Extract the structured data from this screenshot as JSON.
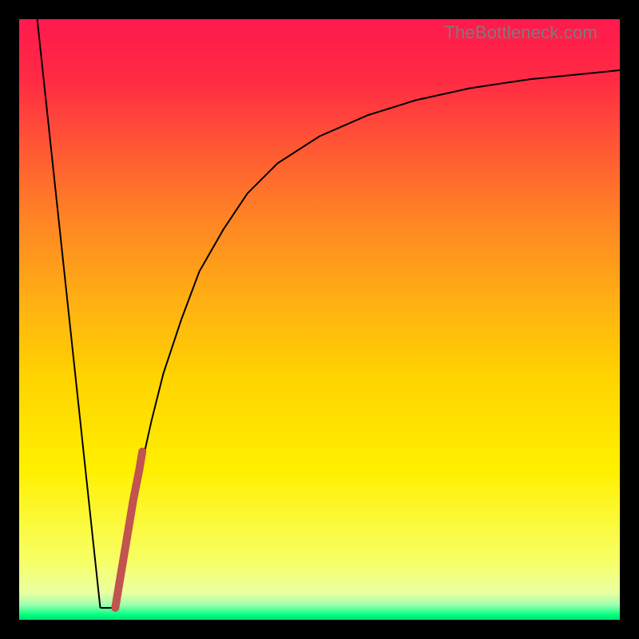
{
  "watermark": "TheBottleneck.com",
  "chart_data": {
    "type": "line",
    "title": "",
    "xlabel": "",
    "ylabel": "",
    "xlim": [
      0,
      100
    ],
    "ylim": [
      0,
      100
    ],
    "grid": false,
    "legend": false,
    "series": [
      {
        "name": "left-descent",
        "color": "#000000",
        "width": 2,
        "x": [
          3,
          13.5
        ],
        "y": [
          100,
          2
        ]
      },
      {
        "name": "floor",
        "color": "#000000",
        "width": 2,
        "x": [
          13.5,
          16
        ],
        "y": [
          2,
          2
        ]
      },
      {
        "name": "right-growth",
        "color": "#000000",
        "width": 2,
        "x": [
          16,
          18,
          20,
          22,
          24,
          27,
          30,
          34,
          38,
          43,
          50,
          58,
          66,
          75,
          85,
          95,
          100
        ],
        "y": [
          2,
          13,
          24,
          33,
          41,
          50,
          58,
          65,
          71,
          76,
          80.5,
          84,
          86.5,
          88.5,
          90,
          91,
          91.5
        ]
      },
      {
        "name": "highlight-segment",
        "color": "#c1544f",
        "width": 10,
        "linecap": "round",
        "x": [
          16,
          17,
          18,
          19,
          20,
          20.5
        ],
        "y": [
          2,
          8,
          14,
          20,
          25,
          28
        ]
      }
    ],
    "background_gradient": {
      "direction": "top-to-bottom",
      "stops": [
        {
          "pos": 0.0,
          "color": "#ff1a4d"
        },
        {
          "pos": 0.35,
          "color": "#ff8a22"
        },
        {
          "pos": 0.6,
          "color": "#ffd400"
        },
        {
          "pos": 0.9,
          "color": "#f8ff64"
        },
        {
          "pos": 0.99,
          "color": "#00ff80"
        }
      ]
    }
  }
}
